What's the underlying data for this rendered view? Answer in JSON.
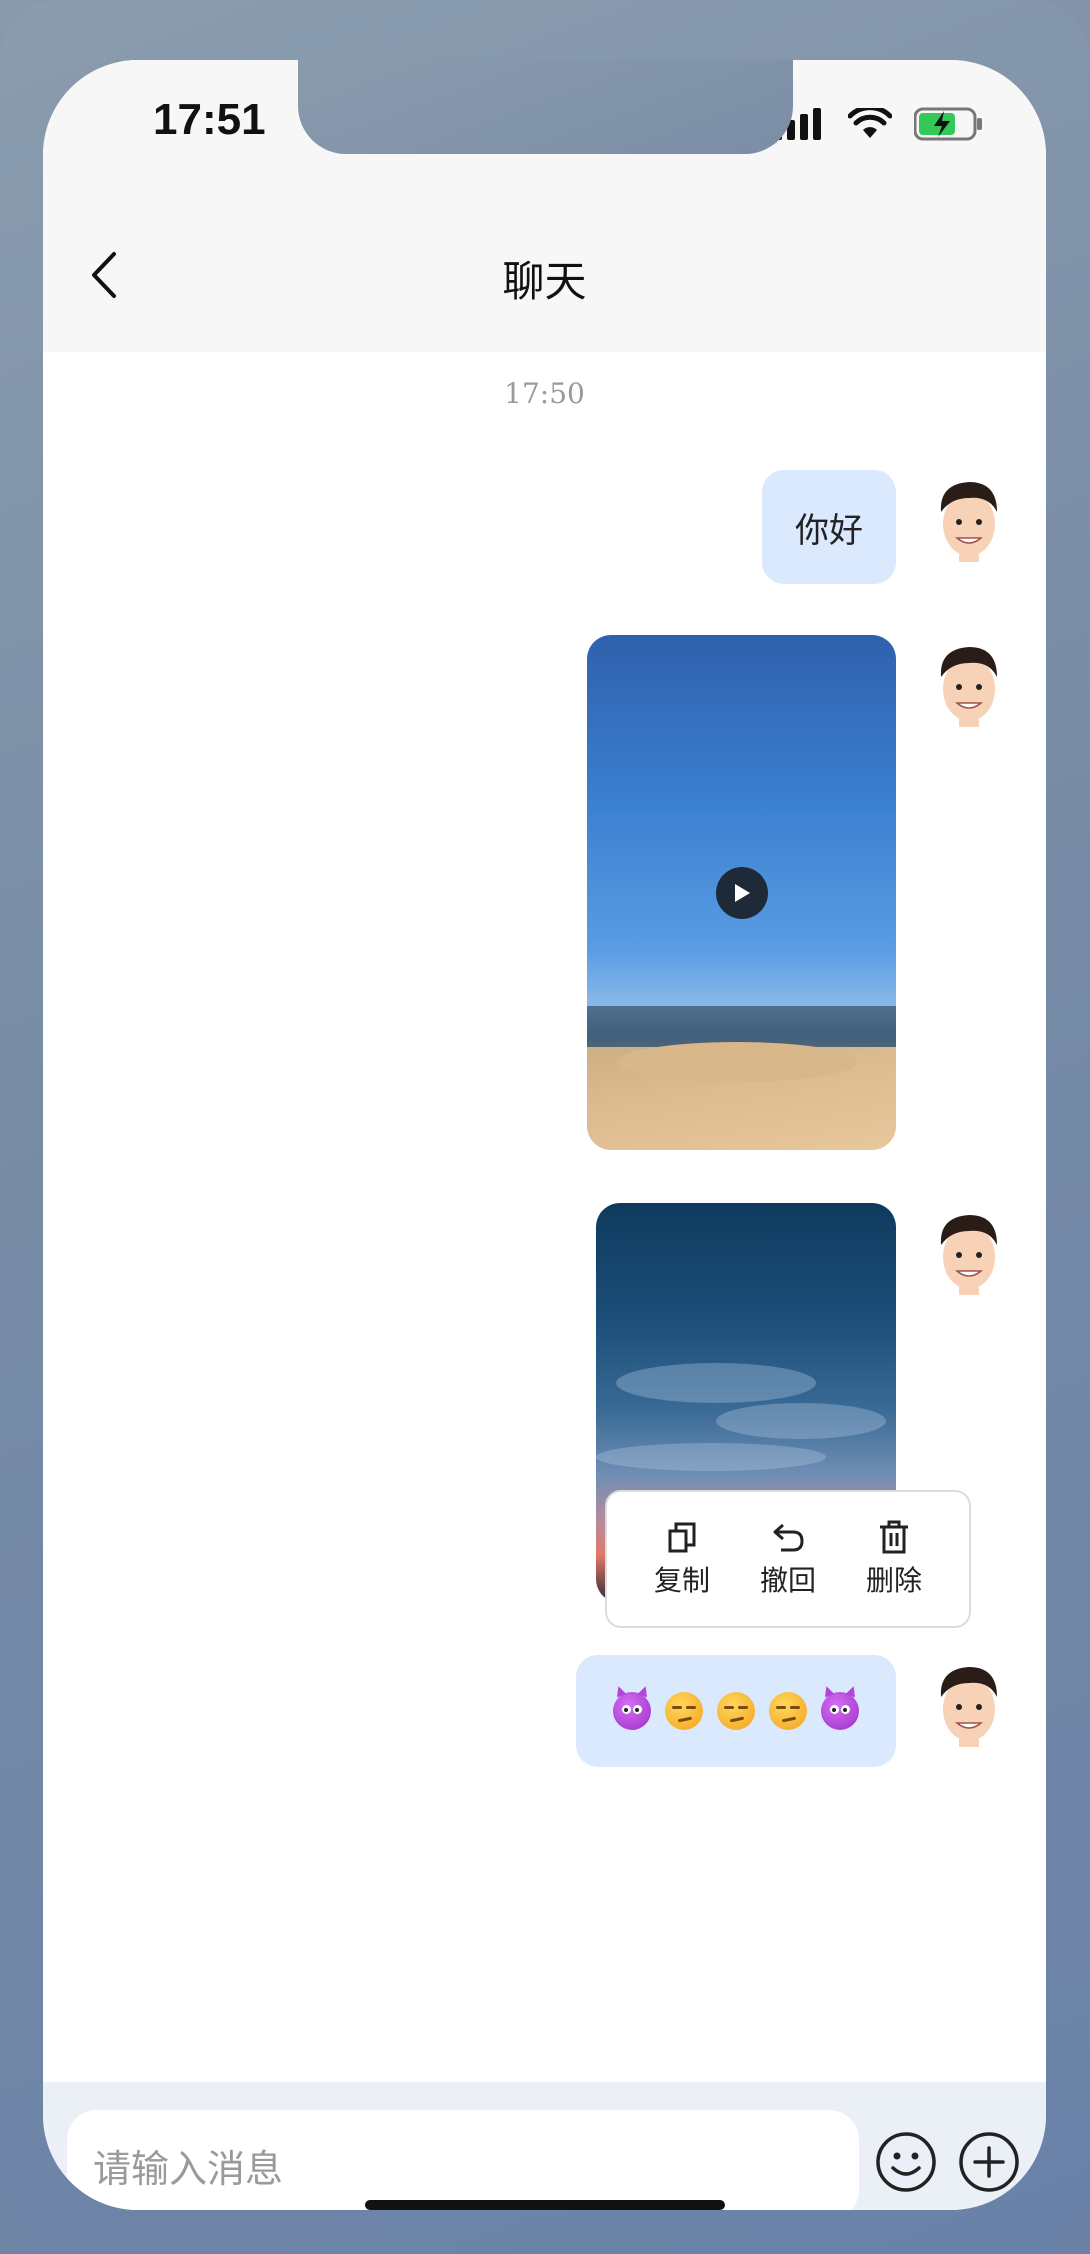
{
  "status_bar": {
    "time": "17:51"
  },
  "header": {
    "title": "聊天"
  },
  "chat": {
    "timestamp": "17:50",
    "messages": [
      {
        "type": "text",
        "text": "你好"
      },
      {
        "type": "video"
      },
      {
        "type": "image"
      },
      {
        "type": "emoji",
        "emojis": [
          "devil-icon",
          "smirk-icon",
          "smirk-icon",
          "smirk-icon",
          "devil-icon"
        ]
      }
    ]
  },
  "context_menu": {
    "copy": "复制",
    "recall": "撤回",
    "delete": "删除"
  },
  "input": {
    "placeholder": "请输入消息"
  },
  "colors": {
    "bubble": "#dae9fd",
    "navbar": "#f7f7f7",
    "battery": "#34c759"
  }
}
